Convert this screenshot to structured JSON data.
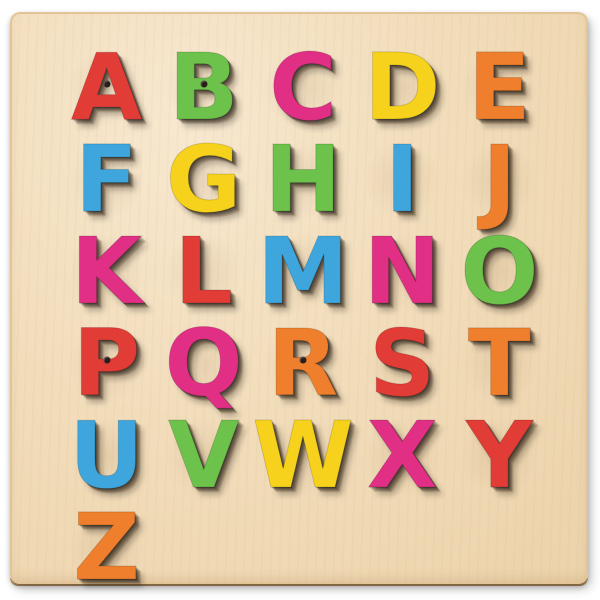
{
  "puzzle": {
    "letters": [
      {
        "char": "A",
        "color": "#e23c36"
      },
      {
        "char": "B",
        "color": "#6cc24a"
      },
      {
        "char": "C",
        "color": "#e12f86"
      },
      {
        "char": "D",
        "color": "#f7d21c"
      },
      {
        "char": "E",
        "color": "#ef7f2c"
      },
      {
        "char": "F",
        "color": "#3ea6dc"
      },
      {
        "char": "G",
        "color": "#f7d21c"
      },
      {
        "char": "H",
        "color": "#6cc24a"
      },
      {
        "char": "I",
        "color": "#3ea6dc"
      },
      {
        "char": "J",
        "color": "#ef7f2c"
      },
      {
        "char": "K",
        "color": "#e12f86"
      },
      {
        "char": "L",
        "color": "#e23c36"
      },
      {
        "char": "M",
        "color": "#3ea6dc"
      },
      {
        "char": "N",
        "color": "#e12f86"
      },
      {
        "char": "O",
        "color": "#6cc24a"
      },
      {
        "char": "P",
        "color": "#e23c36"
      },
      {
        "char": "Q",
        "color": "#e12f86"
      },
      {
        "char": "R",
        "color": "#ef7f2c"
      },
      {
        "char": "S",
        "color": "#e23c36"
      },
      {
        "char": "T",
        "color": "#ef7f2c"
      },
      {
        "char": "U",
        "color": "#3ea6dc"
      },
      {
        "char": "V",
        "color": "#6cc24a"
      },
      {
        "char": "W",
        "color": "#f7d21c"
      },
      {
        "char": "X",
        "color": "#e12f86"
      },
      {
        "char": "Y",
        "color": "#e23c36"
      },
      {
        "char": "Z",
        "color": "#ef7f2c"
      }
    ]
  }
}
